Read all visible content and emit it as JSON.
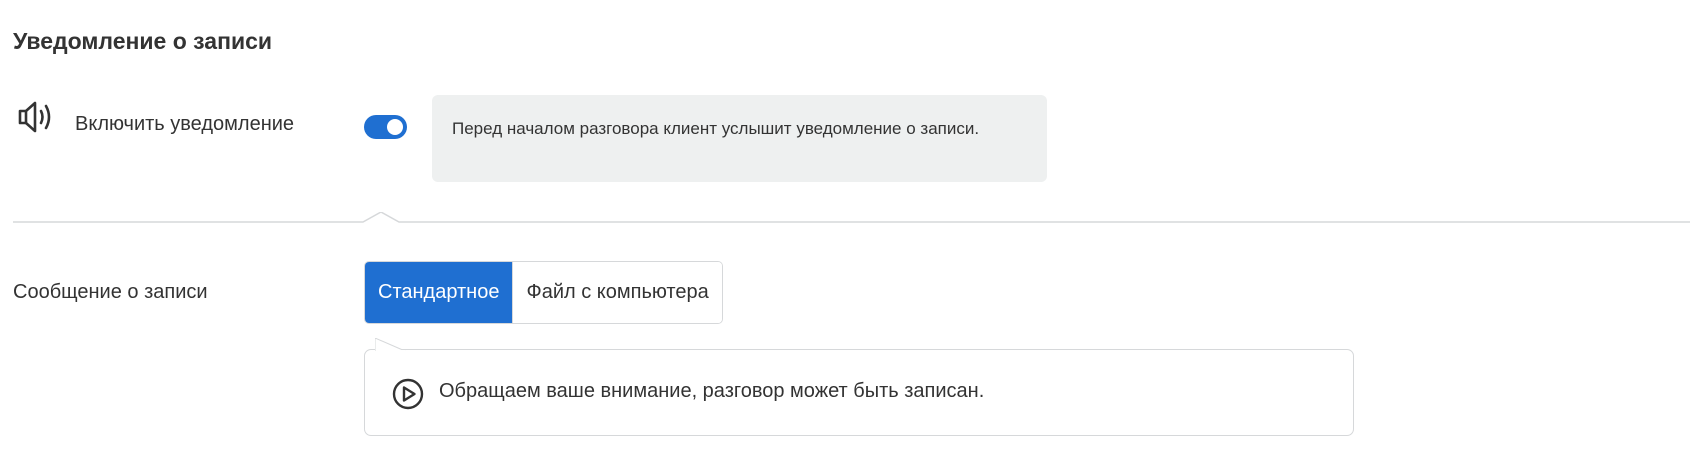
{
  "section": {
    "title": "Уведомление о записи"
  },
  "notification": {
    "enable_label": "Включить уведомление",
    "enabled": true,
    "hint": "Перед началом разговора клиент услышит уведомление о записи."
  },
  "message": {
    "label": "Сообщение о записи",
    "options": [
      "Стандартное",
      "Файл с компьютера"
    ],
    "selected": "Стандартное",
    "text": "Обращаем ваше внимание, разговор может быть записан."
  },
  "icons": {
    "speaker": "speaker-icon",
    "play": "play-circle-icon"
  },
  "colors": {
    "accent": "#1f6fd1",
    "hint_bg": "#eef0f0",
    "text": "#333333",
    "border": "#d6d8da"
  }
}
